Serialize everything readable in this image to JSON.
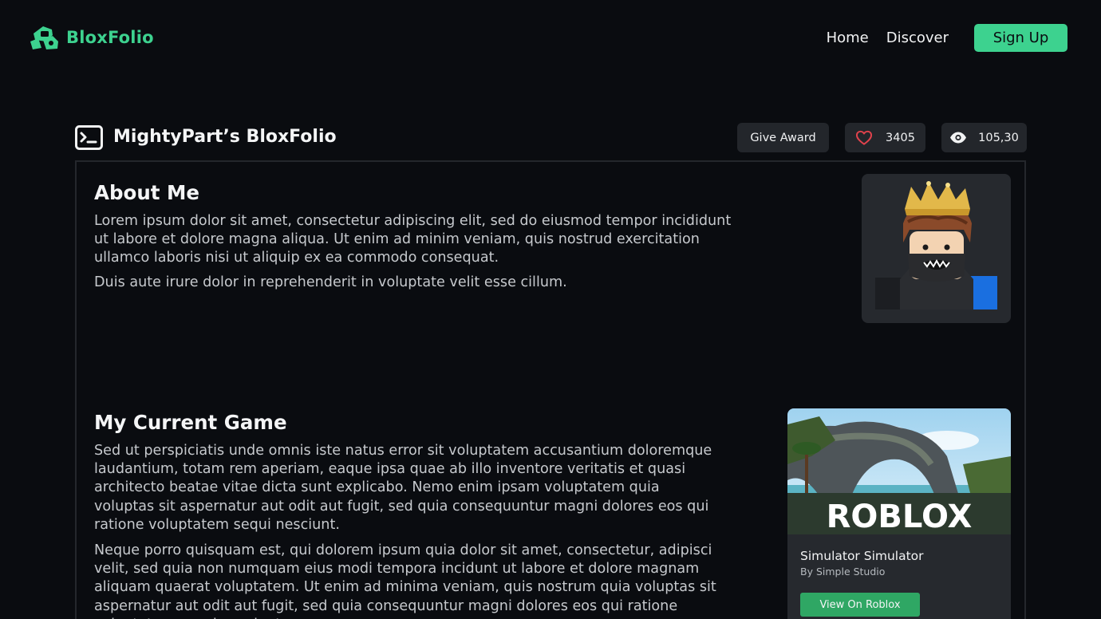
{
  "nav": {
    "brand": "BloxFolio",
    "links": [
      "Home",
      "Discover"
    ],
    "signup_label": "Sign Up"
  },
  "profile": {
    "title": "MightyPart’s BloxFolio",
    "give_award_label": "Give Award",
    "likes": "3405",
    "views": "105,30"
  },
  "about": {
    "title": "About Me",
    "paragraphs": [
      "Lorem ipsum dolor sit amet, consectetur adipiscing elit, sed do eiusmod tempor incididunt ut labore et dolore magna aliqua. Ut enim ad minim veniam, quis nostrud exercitation ullamco laboris nisi ut aliquip ex ea commodo consequat.",
      "Duis aute irure dolor in reprehenderit in voluptate velit esse cillum."
    ]
  },
  "game": {
    "title": "My Current Game",
    "paragraphs": [
      "Sed ut perspiciatis unde omnis iste natus error sit voluptatem accusantium doloremque laudantium, totam rem aperiam, eaque ipsa quae ab illo inventore veritatis et quasi architecto beatae vitae dicta sunt explicabo. Nemo enim ipsam voluptatem quia voluptas sit aspernatur aut odit aut fugit, sed quia consequuntur magni dolores eos qui ratione voluptatem sequi nesciunt.",
      "Neque porro quisquam est, qui dolorem ipsum quia dolor sit amet, consectetur, adipisci velit, sed quia non numquam eius modi tempora incidunt ut labore et dolore magnam aliquam quaerat voluptatem. Ut enim ad minima veniam, quis nostrum quia voluptas sit aspernatur aut odit aut fugit, sed quia consequuntur magni dolores eos qui ratione voluptatem sequi nesciunt."
    ],
    "card": {
      "thumb_logo": "ROBLOX",
      "name": "Simulator Simulator",
      "studio": "By Simple Studio",
      "button_label": "View On Roblox"
    }
  },
  "icons": {
    "brand": "bloxfolio-logo-icon",
    "profile": "terminal-icon",
    "likes": "heart-icon",
    "views": "eye-icon"
  },
  "colors": {
    "accent": "#3dd28f",
    "background": "#0a0c10",
    "surface": "#26292e",
    "heart": "#e0424c",
    "button_green": "#2fa764"
  }
}
